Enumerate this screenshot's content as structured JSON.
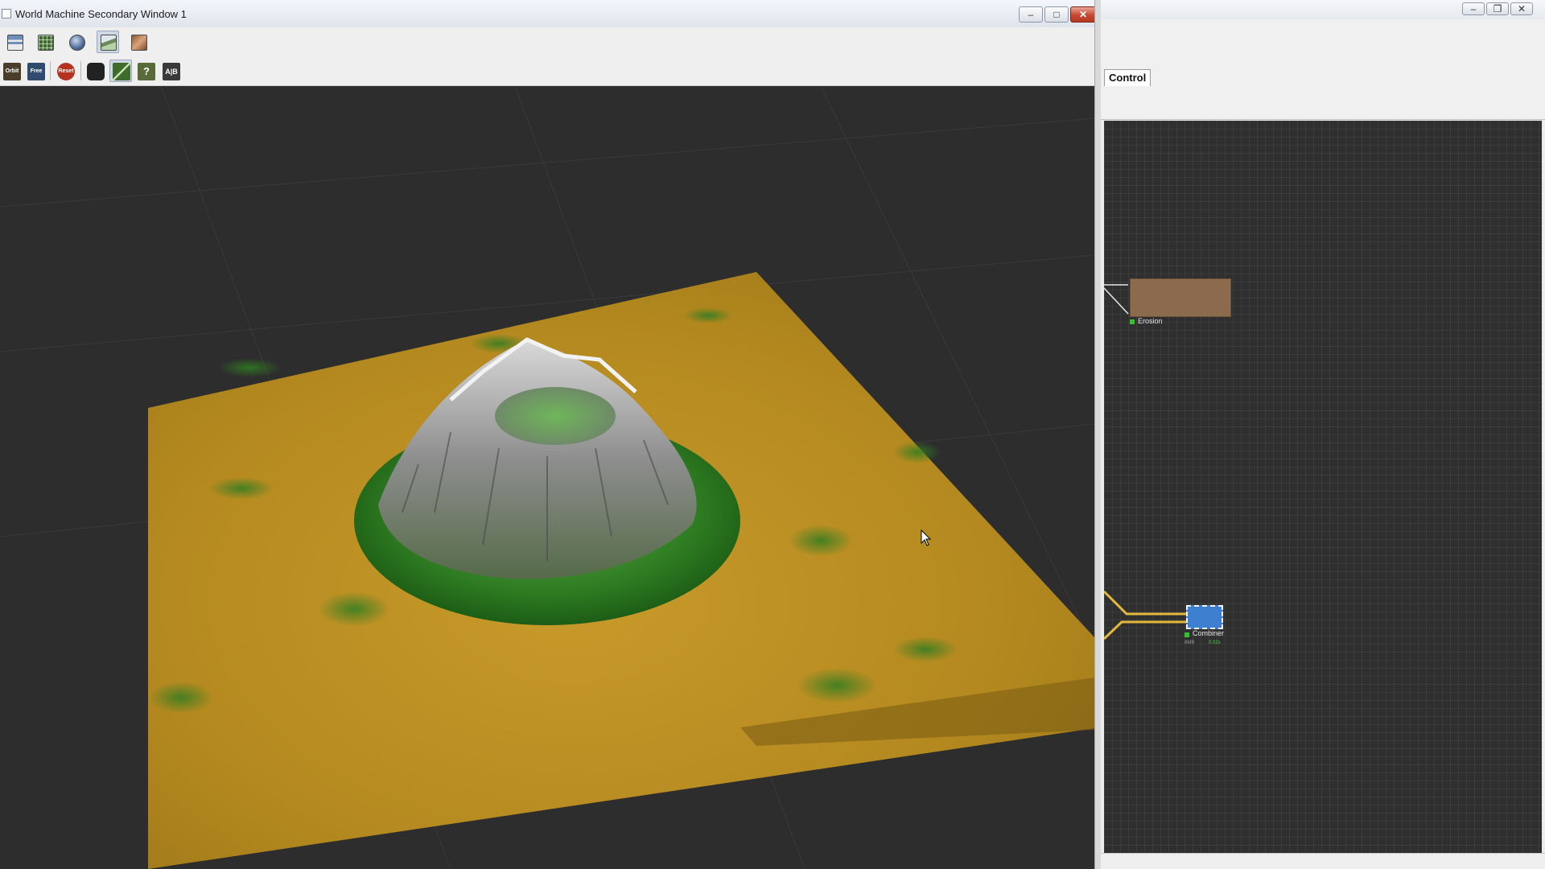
{
  "secondary_window": {
    "title": "World Machine Secondary Window 1",
    "caption_buttons": {
      "minimize": "–",
      "maximize": "□",
      "close": "✕"
    },
    "toolbar_row1": [
      {
        "name": "layout-view-icon",
        "active": false
      },
      {
        "name": "terrain-map-icon",
        "active": false
      },
      {
        "name": "globe-view-icon",
        "active": false
      },
      {
        "name": "3d-preview-icon",
        "active": true
      },
      {
        "name": "texture-view-icon",
        "active": false
      }
    ],
    "toolbar_row2": [
      {
        "name": "orbit-camera-icon",
        "label": "Orbit"
      },
      {
        "name": "free-camera-icon",
        "label": "Free"
      },
      {
        "name": "reset-camera-icon",
        "label": "Reset"
      },
      {
        "name": "snapshot-camera-icon",
        "label": ""
      },
      {
        "name": "wireframe-toggle-icon",
        "label": ""
      },
      {
        "name": "help-icon",
        "label": "?"
      },
      {
        "name": "ab-compare-icon",
        "label": "A|B"
      }
    ]
  },
  "main_window": {
    "caption_buttons": {
      "minimize": "–",
      "restore": "❐",
      "close": "✕"
    },
    "tab_label": "Control"
  },
  "graph": {
    "nodes": {
      "erosion": {
        "label": "Erosion",
        "color": "#8b6a4d"
      },
      "combiner": {
        "label": "Combiner",
        "memory": "8MB",
        "time": "0.02s",
        "color": "#3f7fd0"
      }
    }
  },
  "colors": {
    "viewport_background": "#2d2d2d",
    "terrain_lowland": "#b18a1c",
    "terrain_vegetation": "#3a8a2a",
    "terrain_rock": "#8a8a8a",
    "wire_color": "#e3b93c",
    "status_ok": "#35c22f"
  }
}
